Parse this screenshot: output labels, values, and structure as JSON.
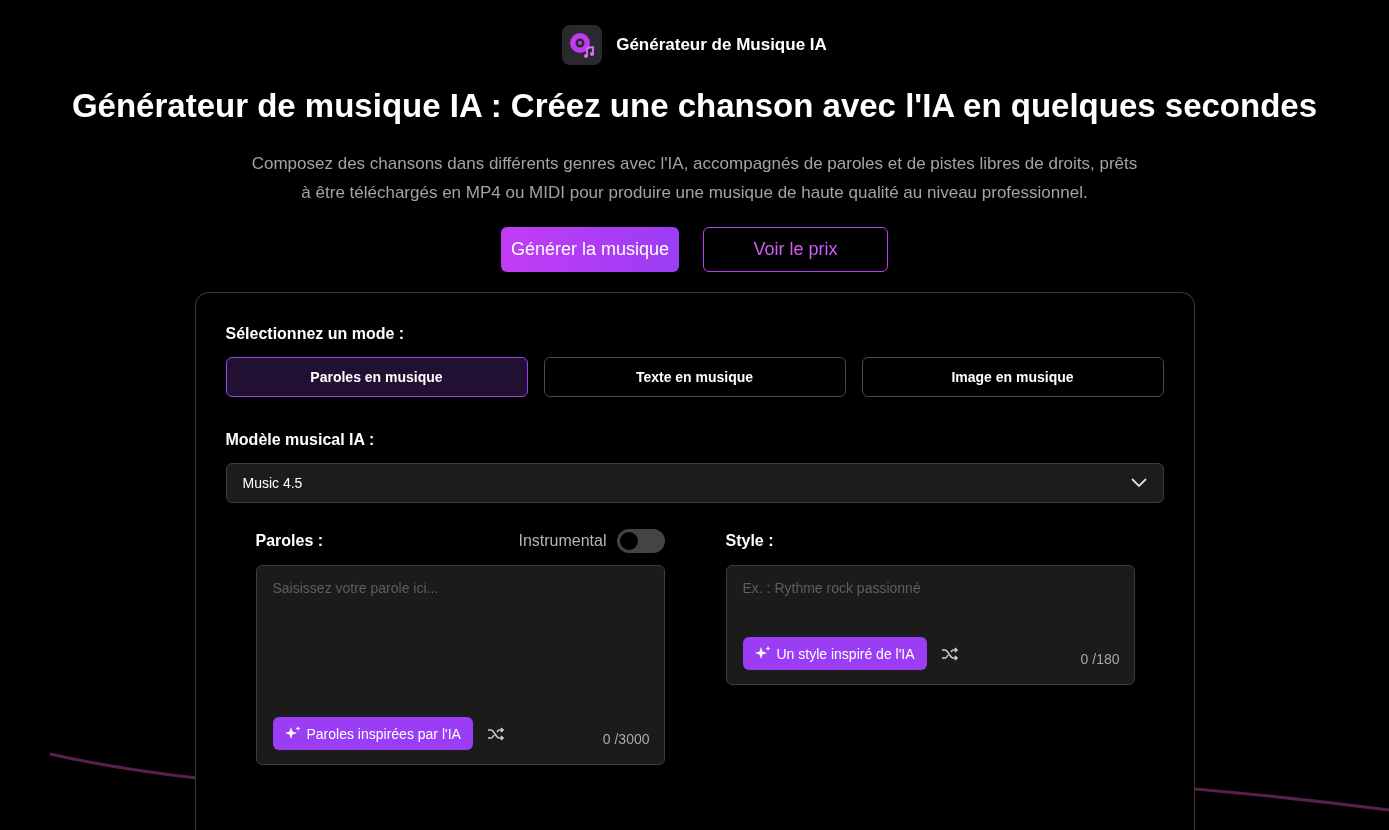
{
  "header": {
    "title": "Générateur de Musique IA"
  },
  "hero": {
    "title": "Générateur de musique IA : Créez une chanson avec l'IA en quelques secondes",
    "description": "Composez des chansons dans différents genres avec l'IA, accompagnés de paroles et de pistes libres de droits, prêts à être téléchargés en MP4 ou MIDI pour produire une musique de haute qualité au niveau professionnel.",
    "buttons": [
      {
        "label": "Générer la musique",
        "kind": "primary"
      },
      {
        "label": "Voir le prix",
        "kind": "outline"
      }
    ]
  },
  "form": {
    "mode_label": "Sélectionnez un mode :",
    "modes": [
      {
        "label": "Paroles en musique",
        "selected": true
      },
      {
        "label": "Texte en musique",
        "selected": false
      },
      {
        "label": "Image en musique",
        "selected": false
      }
    ],
    "model_label": "Modèle musical IA :",
    "model": {
      "value": "Music 4.5"
    },
    "lyrics": {
      "label": "Paroles :",
      "instrumental": {
        "label": "Instrumental",
        "on": false
      },
      "placeholder": "Saisissez votre parole ici...",
      "ai_button": "Paroles inspirées par l'IA",
      "count": "0 /3000"
    },
    "style": {
      "label": "Style :",
      "placeholder": "Ex. : Rythme rock passionné",
      "ai_button": "Un style inspiré de l'IA",
      "count": "0 /180"
    }
  }
}
